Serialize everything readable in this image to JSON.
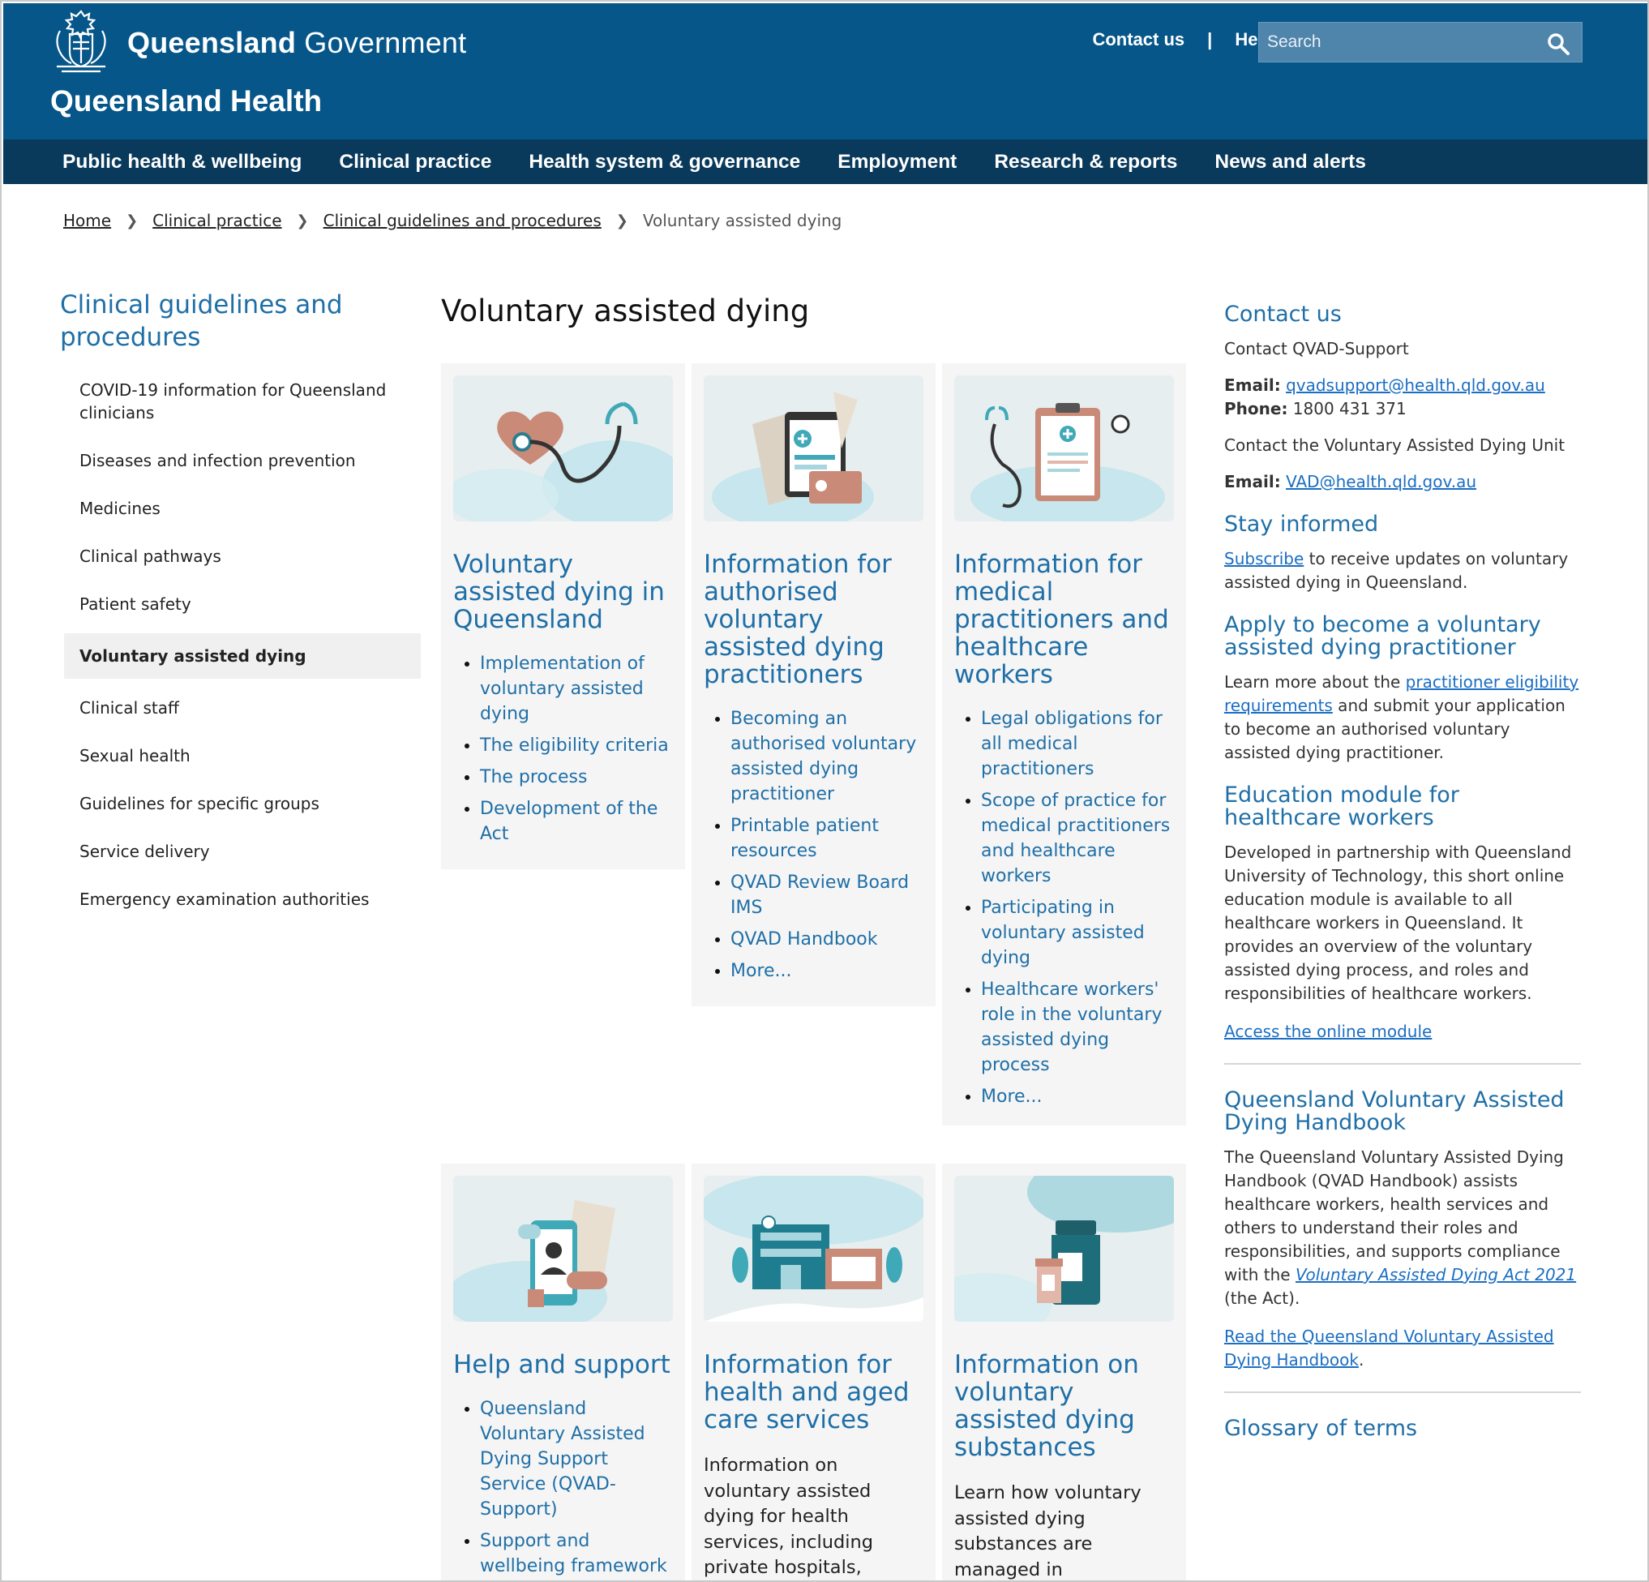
{
  "header": {
    "gov_name_bold": "Queensland",
    "gov_name_light": "Government",
    "site_name": "Queensland Health",
    "contact_label": "Contact us",
    "separator": "|",
    "help_label": "Help",
    "search_placeholder": "Search"
  },
  "mainnav": [
    "Public health & wellbeing",
    "Clinical practice",
    "Health system & governance",
    "Employment",
    "Research & reports",
    "News and alerts"
  ],
  "breadcrumb": {
    "home": "Home",
    "level1": "Clinical practice",
    "level2": "Clinical guidelines and procedures",
    "current": "Voluntary assisted dying"
  },
  "sidenav": {
    "title": "Clinical guidelines and procedures",
    "items": [
      "COVID-19 information for Queensland clinicians",
      "Diseases and infection prevention",
      "Medicines",
      "Clinical pathways",
      "Patient safety",
      "Voluntary assisted dying",
      "Clinical staff",
      "Sexual health",
      "Guidelines for specific groups",
      "Service delivery",
      "Emergency examination authorities"
    ],
    "active_index": 5
  },
  "main": {
    "title": "Voluntary assisted dying",
    "cards": [
      {
        "title": "Voluntary assisted dying in Queensland",
        "links": [
          "Implementation of voluntary assisted dying",
          "The eligibility criteria",
          "The process",
          "Development of the Act"
        ]
      },
      {
        "title": "Information for authorised voluntary assisted dying practitioners",
        "links": [
          "Becoming an authorised voluntary assisted dying practitioner",
          "Printable patient resources",
          "QVAD Review Board IMS",
          "QVAD Handbook",
          "More..."
        ]
      },
      {
        "title": "Information for medical practitioners and healthcare workers",
        "links": [
          "Legal obligations for all medical practitioners",
          "Scope of practice for medical practitioners and healthcare workers",
          "Participating in voluntary assisted dying",
          "Healthcare workers' role in the voluntary assisted dying process",
          "More..."
        ]
      },
      {
        "title": "Help and support",
        "links": [
          "Queensland Voluntary Assisted Dying Support Service (QVAD-Support)",
          "Support and wellbeing framework"
        ]
      },
      {
        "title": "Information for health and aged care services",
        "text": "Information on voluntary assisted dying for health services, including private hospitals, hospices and residential aged care"
      },
      {
        "title": "Information on voluntary assisted dying substances",
        "text": "Learn how voluntary assisted dying substances are managed in Queensland, including QVAD-Pharmacy and"
      }
    ]
  },
  "aside": {
    "contact": {
      "heading": "Contact us",
      "line1": "Contact QVAD-Support",
      "email_label": "Email:",
      "email1": "qvadsupport@health.qld.gov.au",
      "phone_label": "Phone:",
      "phone": "1800 431 371",
      "line2": "Contact the Voluntary Assisted Dying Unit",
      "email2": "VAD@health.qld.gov.au"
    },
    "stay_informed": {
      "heading": "Stay informed",
      "link": "Subscribe",
      "text": " to receive updates on voluntary assisted dying in Queensland."
    },
    "apply": {
      "heading": "Apply to become a voluntary assisted dying practitioner",
      "text1": "Learn more about the ",
      "link": "practitioner eligibility requirements",
      "text2": " and submit your application to become an authorised voluntary assisted dying practitioner."
    },
    "education": {
      "heading": "Education module for healthcare workers",
      "text": "Developed in partnership with Queensland University of Technology, this short online education module is available to all healthcare workers in Queensland. It provides an overview of the voluntary assisted dying process, and roles and responsibilities of healthcare workers.",
      "link": "Access the online module"
    },
    "handbook": {
      "heading": "Queensland Voluntary Assisted Dying Handbook",
      "text1": "The Queensland Voluntary Assisted Dying Handbook (QVAD Handbook) assists healthcare workers, health services and others to understand their roles and responsibilities, and supports compliance with the ",
      "act_link": "Voluntary Assisted Dying Act 2021",
      "text2": " (the Act).",
      "link": "Read the Queensland Voluntary Assisted Dying Handbook",
      "link_suffix": "."
    },
    "glossary": {
      "heading": "Glossary of terms"
    }
  },
  "colors": {
    "masthead": "#06568a",
    "nav": "#09395b",
    "link": "#1f6fa7",
    "card_bg": "#f5f5f5"
  },
  "icons": [
    "qld-coat-of-arms-logo",
    "search-icon",
    "chevron-right-icon"
  ]
}
